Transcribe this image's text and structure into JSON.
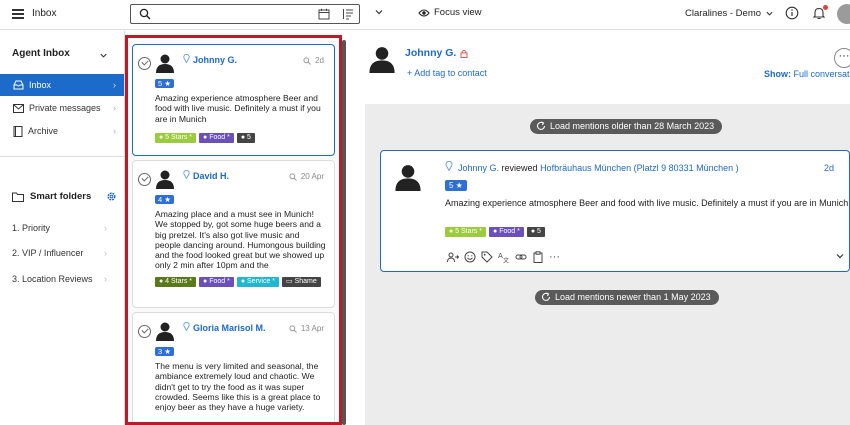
{
  "topbar": {
    "title": "Inbox",
    "search_placeholder": "",
    "focus_label": "Focus view",
    "org_label": "Claralines - Demo"
  },
  "sidebar": {
    "section_title": "Agent Inbox",
    "items": [
      {
        "label": "Inbox",
        "icon": "inbox-icon",
        "active": true
      },
      {
        "label": "Private messages",
        "icon": "envelope-icon",
        "active": false
      },
      {
        "label": "Archive",
        "icon": "book-icon",
        "active": false
      }
    ],
    "smart_folders_label": "Smart folders",
    "folders": [
      {
        "label": "1. Priority"
      },
      {
        "label": "2. VIP / Influencer"
      },
      {
        "label": "3. Location Reviews"
      }
    ]
  },
  "mentions": [
    {
      "name": "Johnny G.",
      "age": "2d",
      "rating": "5 ★",
      "text": "Amazing experience atmosphere Beer and food with live music. Definitely a must if you are in Munich",
      "tags": [
        {
          "label": "● 5 Stars *",
          "color": "#9ccc3d"
        },
        {
          "label": "● Food *",
          "color": "#6b4fbb"
        },
        {
          "label": "● 5",
          "color": "#444444"
        }
      ]
    },
    {
      "name": "David H.",
      "age": "20 Apr",
      "rating": "4 ★",
      "text": "Amazing place and a must see in Munich! We stopped by, got some huge beers and a big pretzel. It's also got live music and people dancing around. Humongous building and the food looked great but we showed up only 2 min after 10pm and the",
      "tags": [
        {
          "label": "● 4 Stars *",
          "color": "#5a7a1a"
        },
        {
          "label": "● Food *",
          "color": "#6b4fbb"
        },
        {
          "label": "● Service *",
          "color": "#1fb8d0"
        },
        {
          "label": "▭ Shame",
          "color": "#444444"
        }
      ]
    },
    {
      "name": "Gloria Marisol M.",
      "age": "13 Apr",
      "rating": "3 ★",
      "text": "The menu is very limited and seasonal, the ambiance extremely loud and chaotic. We didn't get to try the food as it was super crowded. Seems like this is a great place to enjoy beer as they have a huge variety.",
      "tags": []
    }
  ],
  "detail": {
    "name": "Johnny G.",
    "add_tag": "+ Add tag to contact",
    "show_label": "Show:",
    "show_value": "Full conversation",
    "load_older": "Load mentions older than 28 March 2023",
    "load_newer": "Load mentions newer than 1 May 2023",
    "mention": {
      "author": "Johnny G.",
      "verb": " reviewed ",
      "place": "Hofbräuhaus München (Platzl 9 80331 München )",
      "age": "2d",
      "rating": "5 ★",
      "text": "Amazing experience atmosphere Beer and food with live music. Definitely a must if you are in Munich",
      "tags": [
        {
          "label": "● 5 Stars *",
          "color": "#9ccc3d"
        },
        {
          "label": "● Food *",
          "color": "#6b4fbb"
        },
        {
          "label": "● 5",
          "color": "#444444"
        }
      ]
    }
  }
}
